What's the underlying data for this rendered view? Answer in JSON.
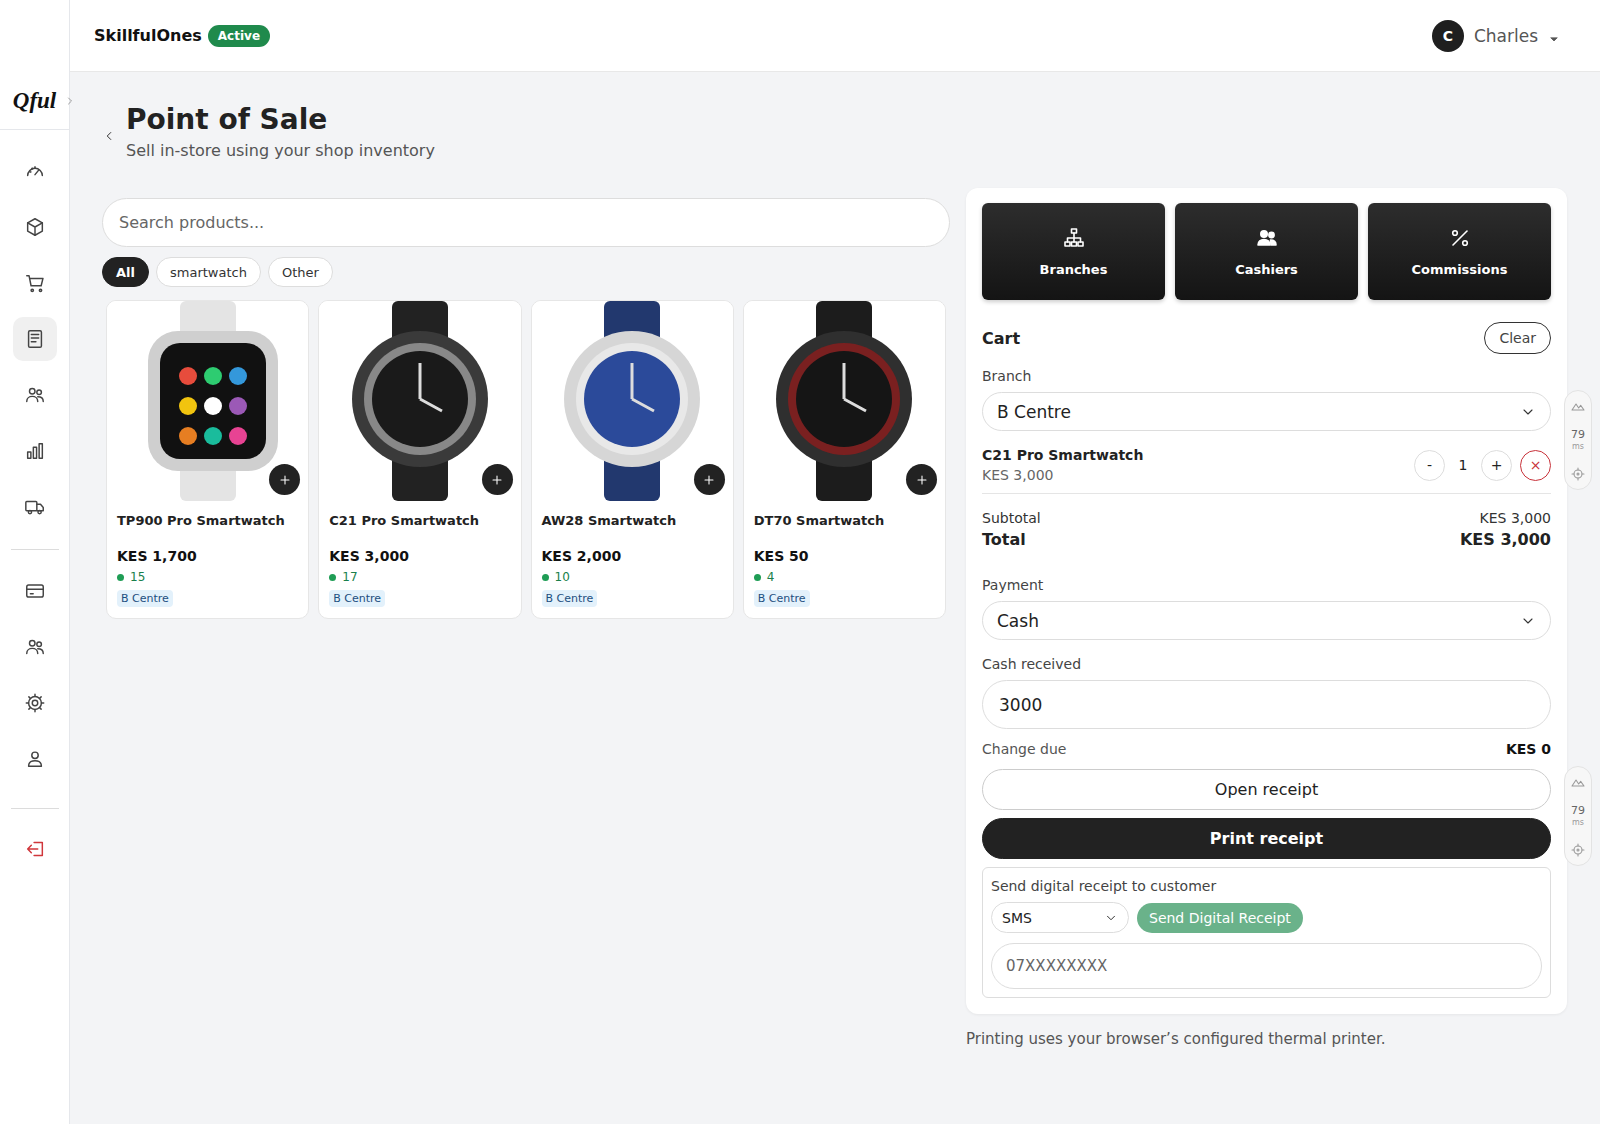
{
  "sidebar": {
    "logo": "Qful",
    "groups": [
      [
        {
          "selected": false
        },
        {
          "selected": false
        },
        {
          "selected": false
        },
        {
          "selected": true
        },
        {
          "selected": false
        },
        {
          "selected": false
        },
        {
          "selected": false
        }
      ],
      [
        {
          "selected": false
        },
        {
          "selected": false
        },
        {
          "selected": false
        },
        {
          "selected": false
        }
      ],
      [
        {
          "selected": false
        }
      ]
    ]
  },
  "header": {
    "org": "SkillfulOnes",
    "status": "Active",
    "user": {
      "initial": "C",
      "name": "Charles"
    }
  },
  "page": {
    "title": "Point of Sale",
    "subtitle": "Sell in-store using your shop inventory"
  },
  "search": {
    "placeholder": "Search products..."
  },
  "filters": [
    {
      "label": "All",
      "selected": true
    },
    {
      "label": "smartwatch",
      "selected": false
    },
    {
      "label": "Other",
      "selected": false
    }
  ],
  "products": [
    {
      "name": "TP900 Pro Smartwatch",
      "price": "KES 1,700",
      "stock": "15",
      "in_stock": true,
      "branch": "B Centre"
    },
    {
      "name": "C21 Pro Smartwatch",
      "price": "KES 3,000",
      "stock": "17",
      "in_stock": true,
      "branch": "B Centre"
    },
    {
      "name": "AW28 Smartwatch",
      "price": "KES 2,000",
      "stock": "10",
      "in_stock": true,
      "branch": "B Centre"
    },
    {
      "name": "DT70 Smartwatch",
      "price": "KES 50",
      "stock": "4",
      "in_stock": true,
      "branch": "B Centre"
    }
  ],
  "panel": {
    "tools": [
      {
        "label": "Branches"
      },
      {
        "label": "Cashiers"
      },
      {
        "label": "Commissions"
      }
    ],
    "cart": {
      "title": "Cart",
      "clear": "Clear",
      "branch_label": "Branch",
      "branch": "B Centre",
      "items": [
        {
          "name": "C21 Pro Smartwatch",
          "price": "KES 3,000",
          "dec": "-",
          "qty": "1",
          "inc": "+",
          "remove": "×"
        }
      ],
      "subtotal_label": "Subtotal",
      "subtotal": "KES 3,000",
      "total_label": "Total",
      "total": "KES 3,000"
    },
    "payment": {
      "label": "Payment",
      "method": "Cash",
      "cash_label": "Cash received",
      "cash": "3000",
      "change_label": "Change due",
      "change": "KES 0"
    },
    "actions": {
      "open": "Open receipt",
      "print": "Print receipt"
    },
    "digital": {
      "label": "Send digital receipt to customer",
      "channel": "SMS",
      "send": "Send Digital Receipt",
      "phone_placeholder": "07XXXXXXXX"
    }
  },
  "note": "Printing uses your browser’s configured thermal printer.",
  "widgets": [
    {
      "value": "79",
      "unit": "ms"
    },
    {
      "value": "79",
      "unit": "ms"
    }
  ]
}
